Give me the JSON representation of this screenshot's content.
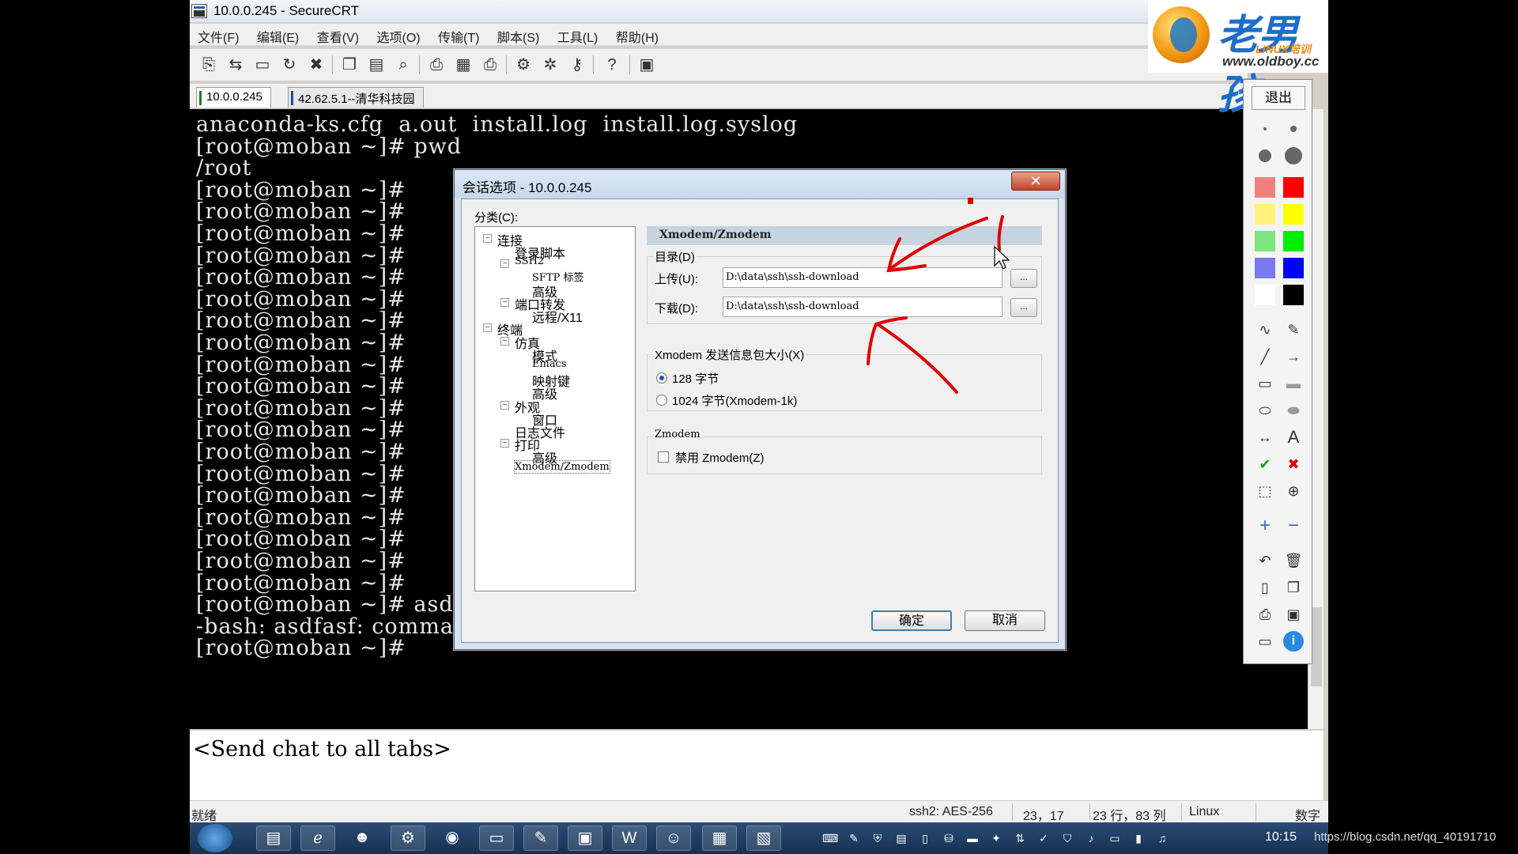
{
  "window": {
    "title": "10.0.0.245 - SecureCRT"
  },
  "menu": [
    "文件(F)",
    "编辑(E)",
    "查看(V)",
    "选项(O)",
    "传输(T)",
    "脚本(S)",
    "工具(L)",
    "帮助(H)"
  ],
  "tabs": [
    {
      "label": "10.0.0.245",
      "active": true
    },
    {
      "label": "42.62.5.1--清华科技园",
      "active": false
    }
  ],
  "terminal": {
    "lines": [
      "anaconda-ks.cfg  a.out  install.log  install.log.syslog",
      "[root@moban ~]# pwd",
      "/root",
      "[root@moban ~]#",
      "[root@moban ~]#",
      "[root@moban ~]#",
      "[root@moban ~]#",
      "[root@moban ~]#",
      "[root@moban ~]#",
      "[root@moban ~]#",
      "[root@moban ~]#",
      "[root@moban ~]#",
      "[root@moban ~]#",
      "[root@moban ~]#",
      "[root@moban ~]#",
      "[root@moban ~]#",
      "[root@moban ~]#",
      "[root@moban ~]#",
      "[root@moban ~]#",
      "[root@moban ~]#",
      "[root@moban ~]#",
      "[root@moban ~]#",
      "[root@moban ~]# asdfasf",
      "-bash: asdfasf: command not found",
      "[root@moban ~]#"
    ]
  },
  "chat": {
    "text": "<Send chat to all tabs>"
  },
  "status": {
    "ready": "就绪",
    "cipher": "ssh2: AES-256",
    "cursor": "23，17",
    "size": "23 行，83 列",
    "os": "Linux",
    "num": "数字"
  },
  "logo": {
    "brand": "老男孩",
    "sub": "LINUX培训",
    "url": "www.oldboy.cc"
  },
  "drawpanel": {
    "exit": "退出"
  },
  "dialog": {
    "title": "会话选项 - 10.0.0.245",
    "close": "✕",
    "category_label": "分类(C):",
    "tree": [
      {
        "label": "连接",
        "level": 0,
        "expander": "−"
      },
      {
        "label": "登录脚本",
        "level": 1
      },
      {
        "label": "SSH2",
        "level": 1,
        "expander": "−"
      },
      {
        "label": "SFTP 标签",
        "level": 2
      },
      {
        "label": "高级",
        "level": 2
      },
      {
        "label": "端口转发",
        "level": 1,
        "expander": "−"
      },
      {
        "label": "远程/X11",
        "level": 2
      },
      {
        "label": "终端",
        "level": 0,
        "expander": "−"
      },
      {
        "label": "仿真",
        "level": 1,
        "expander": "−"
      },
      {
        "label": "模式",
        "level": 2
      },
      {
        "label": "Emacs",
        "level": 2
      },
      {
        "label": "映射键",
        "level": 2
      },
      {
        "label": "高级",
        "level": 2
      },
      {
        "label": "外观",
        "level": 1,
        "expander": "−"
      },
      {
        "label": "窗口",
        "level": 2
      },
      {
        "label": "日志文件",
        "level": 1
      },
      {
        "label": "打印",
        "level": 1,
        "expander": "−"
      },
      {
        "label": "高级",
        "level": 2
      },
      {
        "label": "Xmodem/Zmodem",
        "level": 1,
        "selected": true
      }
    ],
    "header": "Xmodem/Zmodem",
    "dir_group": "目录(D)",
    "upload_label": "上传(U):",
    "upload_value": "D:\\data\\ssh\\ssh-download",
    "download_label": "下载(D):",
    "download_value": "D:\\data\\ssh\\ssh-download",
    "browse": "...",
    "xmodem_group": "Xmodem 发送信息包大小(X)",
    "opt128": "128 字节",
    "opt1024": "1024 字节(Xmodem-1k)",
    "zmodem_group": "Zmodem",
    "zmodem_disable": "禁用 Zmodem(Z)",
    "ok": "确定",
    "cancel": "取消"
  },
  "taskbar": {
    "clock": "10:15"
  },
  "watermark": "https://blog.csdn.net/qq_40191710",
  "colors": {
    "annotation": "#e00000",
    "terminal_bg": "#000000",
    "terminal_fg": "#e8e8e8"
  }
}
